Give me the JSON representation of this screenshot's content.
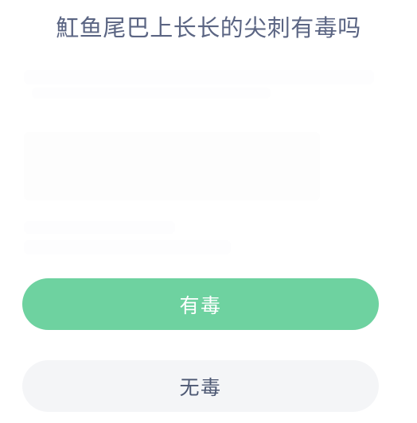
{
  "page": {
    "background_color": "#ffffff",
    "title_color": "#5b6583"
  },
  "question": {
    "text": "魟鱼尾巴上长长的尖刺有毒吗"
  },
  "content": {
    "body_text": ""
  },
  "answers": {
    "options": [
      {
        "label": "有毒",
        "state": "selected",
        "background_color": "#6ed2a0",
        "text_color": "#ffffff"
      },
      {
        "label": "无毒",
        "state": "default",
        "background_color": "#f4f5f7",
        "text_color": "#4d5873"
      }
    ]
  }
}
